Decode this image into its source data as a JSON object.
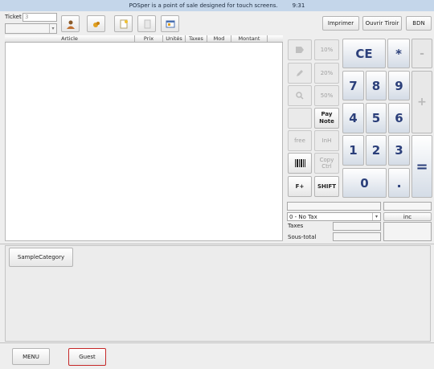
{
  "topbar": {
    "message": "POSper is a point of sale designed for touch screens.",
    "time": "9:31"
  },
  "ticket": {
    "label": "Ticket",
    "number": "3"
  },
  "header_buttons": {
    "print": "Imprimer",
    "open_drawer": "Ouvrir Tiroir",
    "bdn": "BDN"
  },
  "table": {
    "columns": [
      "Article",
      "Prix",
      "Unités",
      "Taxes",
      "Mod",
      "Montant"
    ]
  },
  "side_pad": {
    "pct10": "10%",
    "pct20": "20%",
    "pct50": "50%",
    "pay_note": "Pay Note",
    "free": "free",
    "inh": "InH",
    "copy_ctrl": "Copy Ctrl",
    "f_plus": "F+",
    "shift": "SHIFT"
  },
  "numpad": {
    "ce": "CE",
    "multiply": "*",
    "minus": "-",
    "plus": "+",
    "equals": "=",
    "dot": ".",
    "digits": [
      "7",
      "8",
      "9",
      "4",
      "5",
      "6",
      "1",
      "2",
      "3",
      "0"
    ]
  },
  "totals": {
    "tax_select": "0 - No Tax",
    "inc_button": "inc",
    "taxes_label": "Taxes",
    "subtotal_label": "Sous-total"
  },
  "categories": {
    "items": [
      "SampleCategory"
    ]
  },
  "footer": {
    "menu": "MENU",
    "guest": "Guest"
  }
}
